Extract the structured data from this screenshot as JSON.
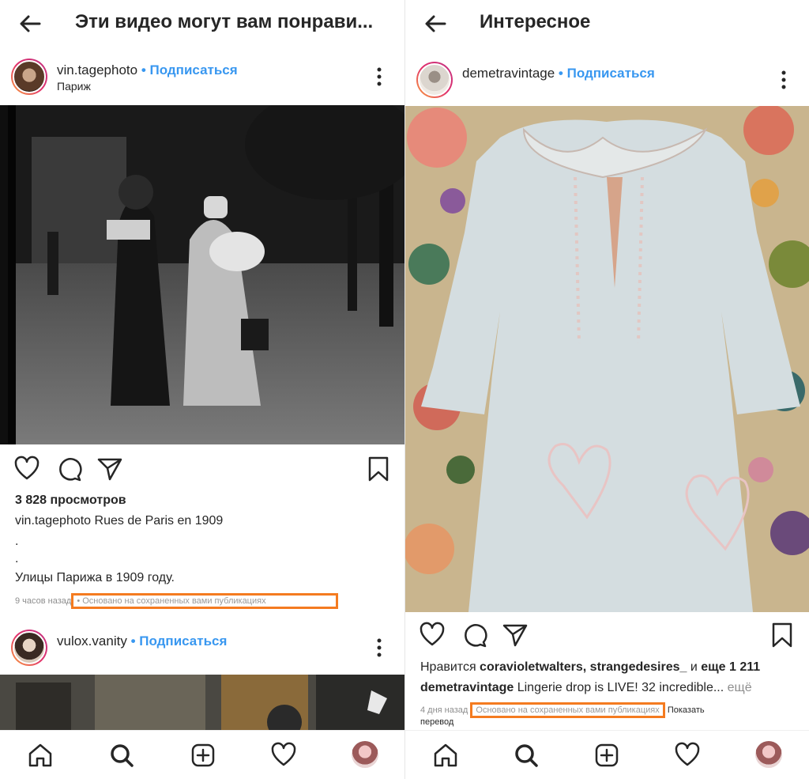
{
  "left": {
    "header_title": "Эти видео могут вам понрави...",
    "post1": {
      "username": "vin.tagephoto",
      "dot": "•",
      "follow": "Подписаться",
      "location": "Париж",
      "views": "3 828 просмотров",
      "caption_user": "vin.tagephoto",
      "caption_text": "Rues de Paris en 1909",
      "caption_dot1": ".",
      "caption_dot2": ".",
      "caption_line2": "Улицы Парижа в 1909 году.",
      "time": "9 часов назад",
      "based_on": "• Основано на сохраненных вами публикациях"
    },
    "post2": {
      "username": "vulox.vanity",
      "dot": "•",
      "follow": "Подписаться"
    }
  },
  "right": {
    "header_title": "Интересное",
    "post": {
      "username": "demetravintage",
      "dot": "•",
      "follow": "Подписаться",
      "likes_prefix": "Нравится ",
      "likes_users": "coravioletwalters, strangedesires_",
      "likes_and": " и ",
      "likes_more": "еще 1 211",
      "caption_user": "demetravintage",
      "caption_text": " Lingerie drop is LIVE! 32 incredible...",
      "caption_more": " ещё",
      "time": "4 дня назад",
      "based_on": "Основано на сохраненных вами публикациях",
      "translate_1": "Показать",
      "translate_2": "перевод"
    }
  },
  "colors": {
    "link_blue": "#3897f0",
    "highlight_orange": "#f47b20",
    "text_dark": "#262626",
    "text_grey": "#8e8e8e"
  },
  "icons": [
    "back-arrow-icon",
    "more-icon",
    "heart-icon",
    "comment-icon",
    "share-icon",
    "bookmark-icon",
    "home-icon",
    "search-icon",
    "add-icon",
    "activity-heart-icon",
    "profile-avatar"
  ]
}
